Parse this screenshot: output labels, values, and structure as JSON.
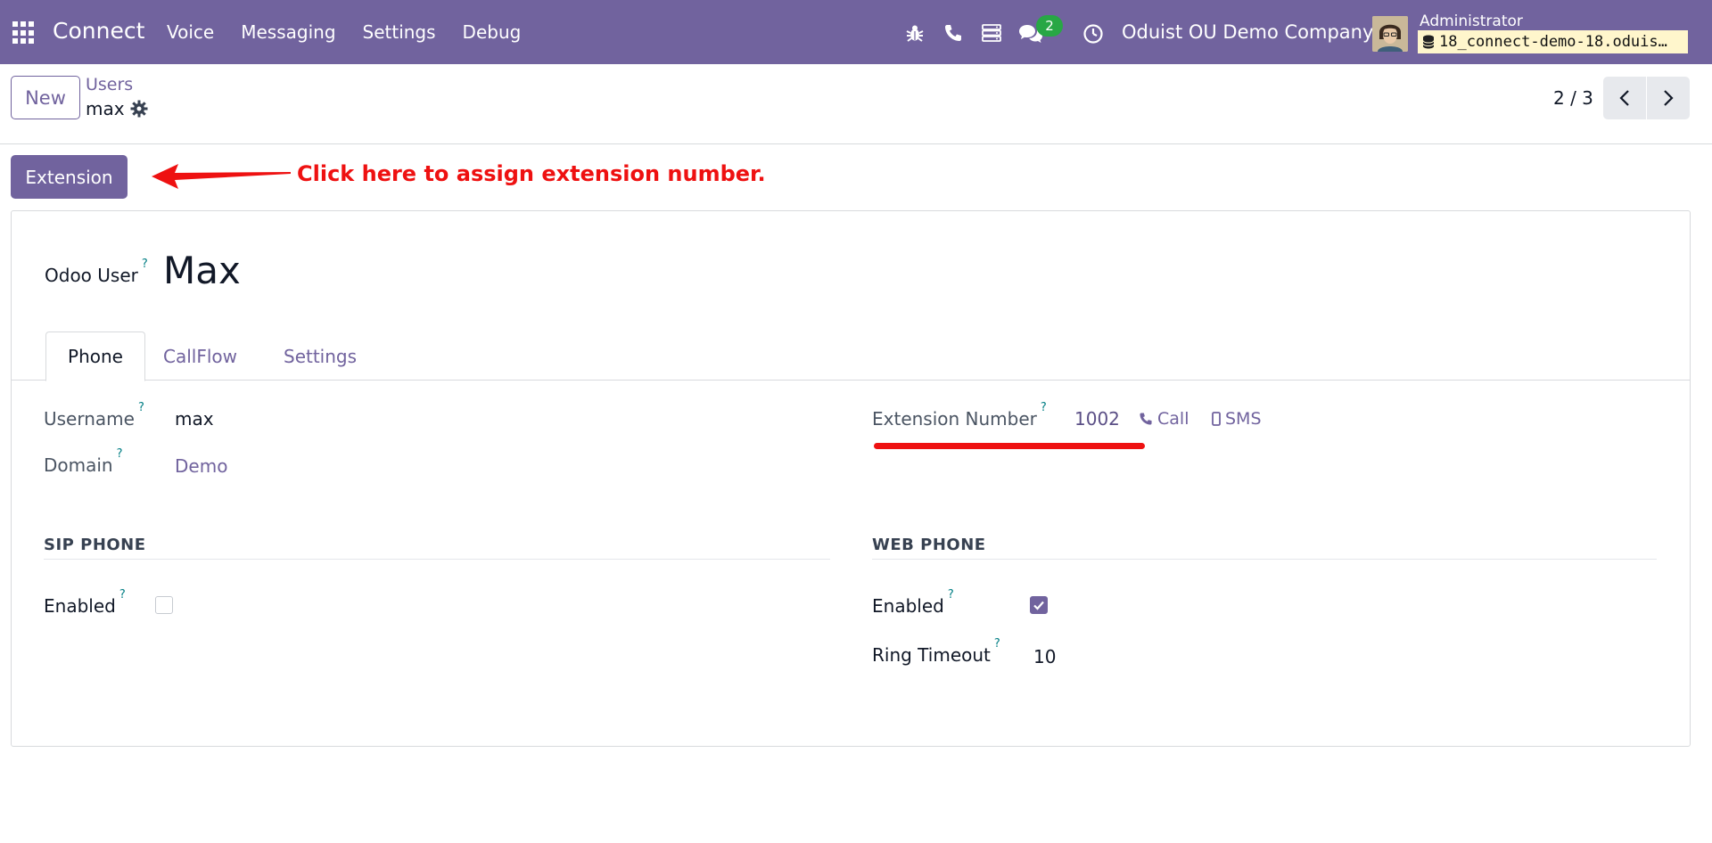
{
  "navbar": {
    "brand": "Connect",
    "menu": [
      "Voice",
      "Messaging",
      "Settings",
      "Debug"
    ],
    "messages_badge": "2",
    "company": "Oduist OU Demo Company",
    "user_name": "Administrator",
    "database": "18_connect-demo-18.oduis…"
  },
  "control_panel": {
    "new_label": "New",
    "breadcrumb_parent": "Users",
    "breadcrumb_current": "max",
    "pager": "2 / 3"
  },
  "actions": {
    "extension_label": "Extension"
  },
  "annotation": {
    "text": "Click here to assign extension number."
  },
  "form": {
    "title_label": "Odoo User",
    "title_value": "Max",
    "help_mark": "?",
    "tabs": [
      "Phone",
      "CallFlow",
      "Settings"
    ],
    "username_label": "Username",
    "username_value": "max",
    "domain_label": "Domain",
    "domain_value": "Demo",
    "extension_label": "Extension Number",
    "extension_value": "1002",
    "call_label": "Call",
    "sms_label": "SMS",
    "sip_section": "SIP PHONE",
    "sip_enabled_label": "Enabled",
    "sip_enabled": false,
    "web_section": "WEB PHONE",
    "web_enabled_label": "Enabled",
    "web_enabled": true,
    "ring_timeout_label": "Ring Timeout",
    "ring_timeout_value": "10"
  },
  "colors": {
    "brand": "#71639e",
    "annotation": "#ee1111",
    "help": "#017e84",
    "badge": "#28a745"
  }
}
